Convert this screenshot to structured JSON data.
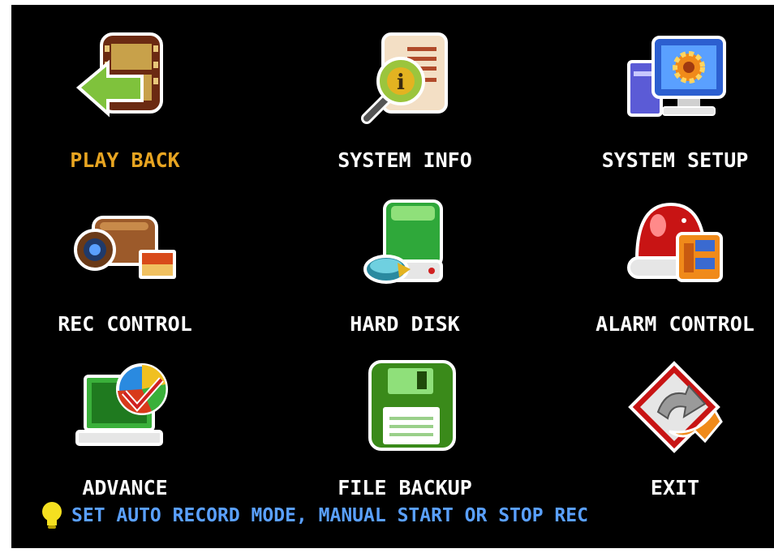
{
  "menu": {
    "items": [
      {
        "label": "PLAY BACK",
        "icon": "playback-icon",
        "selected": true
      },
      {
        "label": "SYSTEM INFO",
        "icon": "info-icon",
        "selected": false
      },
      {
        "label": "SYSTEM SETUP",
        "icon": "setup-icon",
        "selected": false
      },
      {
        "label": "REC CONTROL",
        "icon": "camera-icon",
        "selected": false
      },
      {
        "label": "HARD DISK",
        "icon": "hard-disk-icon",
        "selected": false
      },
      {
        "label": "ALARM CONTROL",
        "icon": "alarm-icon",
        "selected": false
      },
      {
        "label": "ADVANCE",
        "icon": "advance-icon",
        "selected": false
      },
      {
        "label": "FILE BACKUP",
        "icon": "floppy-icon",
        "selected": false
      },
      {
        "label": "EXIT",
        "icon": "exit-icon",
        "selected": false
      }
    ]
  },
  "hint": {
    "icon": "lightbulb-icon",
    "text": "SET AUTO RECORD MODE, MANUAL START OR STOP REC"
  },
  "colors": {
    "background": "#000000",
    "label": "#ffffff",
    "selected_label": "#e8a521",
    "hint_text": "#5aa0ff"
  }
}
